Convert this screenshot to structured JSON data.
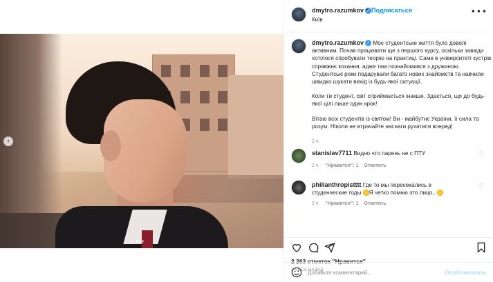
{
  "header": {
    "username": "dmytro.razumkov",
    "separator": "•",
    "follow_label": "Подписаться",
    "location": "Київ",
    "more": "•••"
  },
  "caption": {
    "username": "dmytro.razumkov",
    "paragraphs": [
      "Моє студентське життя було доволі активним. Почав працювати ще з першого курсу, оскільки завжди хотілося спробувати теорію на практиці. Саме в університеті зустрів справжнє кохання, адже там познайомився з дружиною. Студентські роки подарували багато нових знайомств та навчили швидко шукати вихід із будь-якої ситуації.",
      "Коли ти студент, світ сприймається інакше. Здається, що до будь-якої цілі лише один крок!",
      "Вітаю всіх студентів із святом! Ви - майбутнє України, її сила та розум. Ніколи не втрачайте наснаги рухатися вперед!"
    ],
    "time": "2 ч."
  },
  "comments": [
    {
      "username": "stanislav7711",
      "text": "Видно что парень не с ПТУ",
      "time": "2 ч.",
      "like_label": "\"Нравится\": 1",
      "reply_label": "Ответить"
    },
    {
      "username": "phillanthropistttt",
      "text_before": "Где то мы пересекались в студенческие годы",
      "text_after": "Я четко помню это лицо..",
      "time": "2 ч.",
      "like_label": "\"Нравится\": 1",
      "reply_label": "Ответить"
    }
  ],
  "actions": {
    "likes": "2 263 отметок \"Нравится\"",
    "posted": "2 ЧАСА НАЗАД"
  },
  "add_comment": {
    "placeholder": "Добавьте комментарий...",
    "publish_label": "Опубликовать"
  },
  "carousel": {
    "prev": "‹",
    "slide_count": 3,
    "active_slide": 2
  },
  "colors": {
    "link": "#0095f6",
    "verified": "#3897f0",
    "muted": "#8e8e8e",
    "publish_disabled": "#b2dffc"
  },
  "icons": [
    "heart-icon",
    "comment-icon",
    "share-icon",
    "bookmark-icon",
    "emoji-icon",
    "verified-icon",
    "more-icon"
  ]
}
